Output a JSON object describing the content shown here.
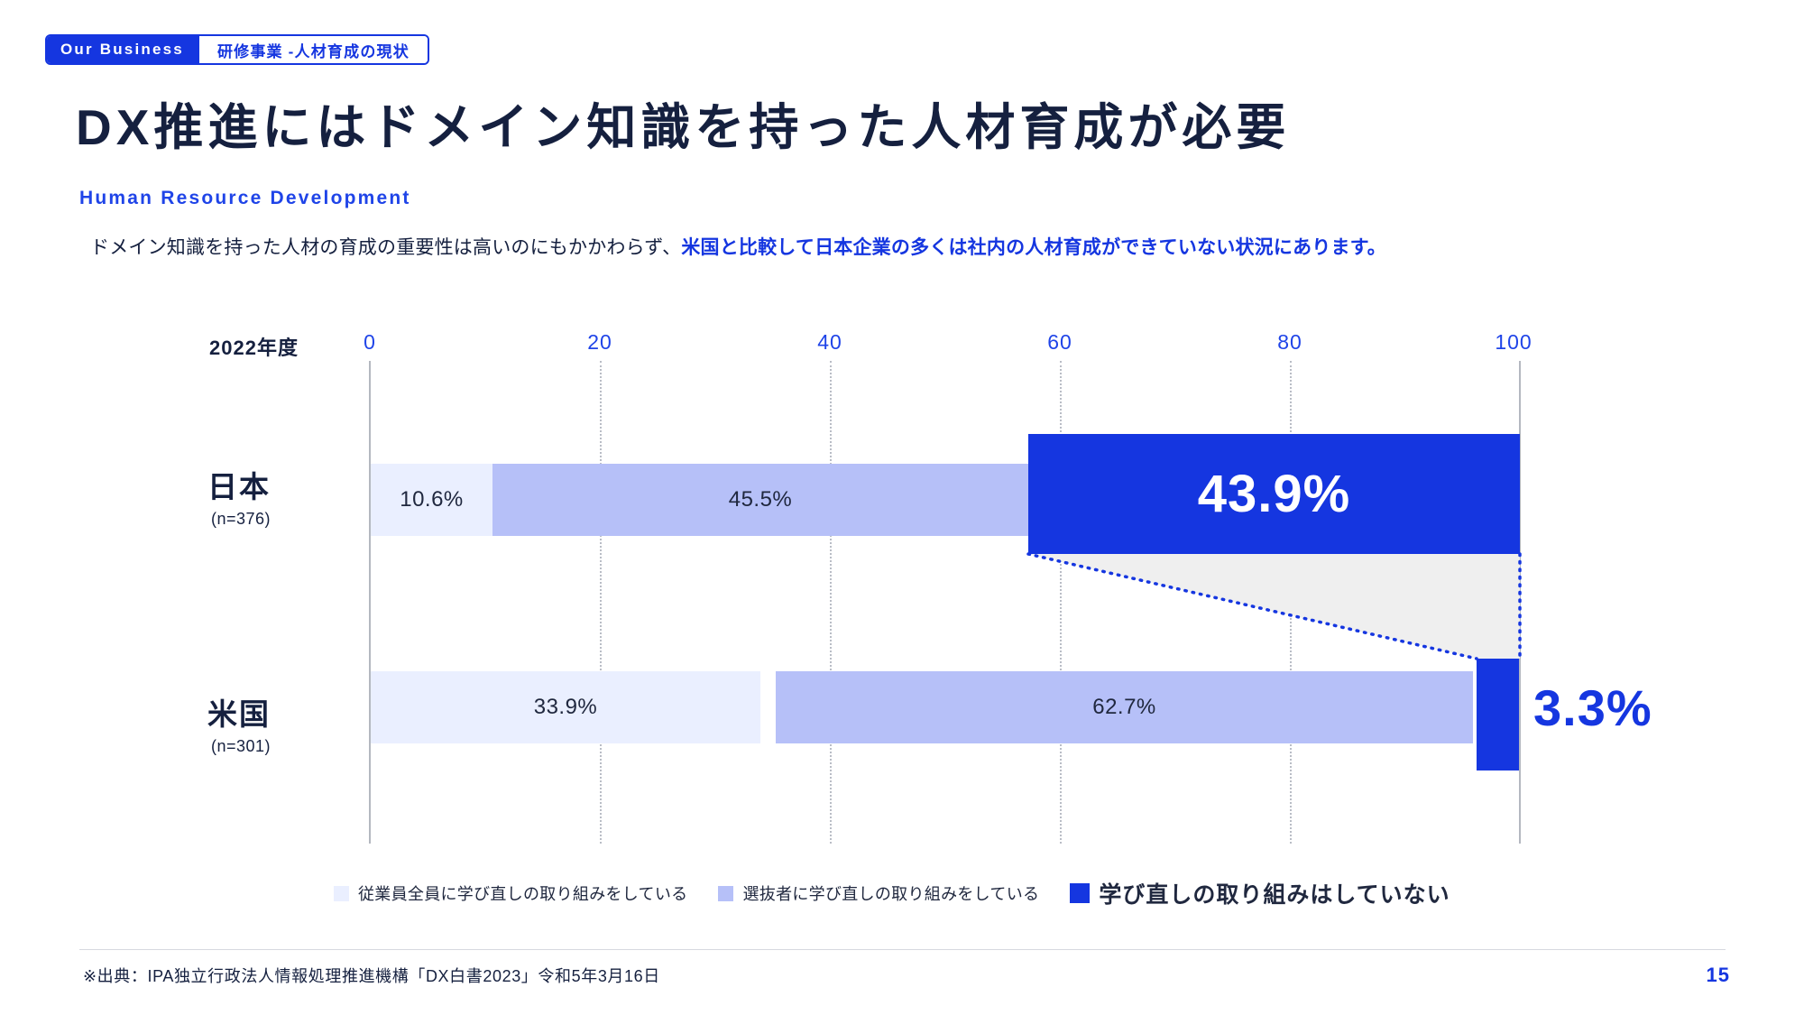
{
  "header": {
    "badge_left": "Our Business",
    "badge_right": "研修事業 -人材育成の現状"
  },
  "title": "DX推進にはドメイン知識を持った人材育成が必要",
  "subtitle": "Human Resource Development",
  "lead": {
    "plain": "ドメイン知識を持った人材の育成の重要性は高いのにもかかわらず、",
    "highlight": "米国と比較して日本企業の多くは社内の人材育成ができていない状況にあります。"
  },
  "footer": {
    "source": "※出典：IPA独立行政法人情報処理推進機構「DX白書2023」令和5年3月16日",
    "page_number": "15"
  },
  "chart_data": {
    "type": "bar",
    "orientation": "horizontal",
    "stacked": true,
    "title": "",
    "year_label": "2022年度",
    "xlabel": "",
    "ylabel": "",
    "xlim": [
      0,
      100
    ],
    "xticks": [
      "0",
      "20",
      "40",
      "60",
      "80",
      "100"
    ],
    "grid": true,
    "legend_position": "bottom",
    "series": [
      {
        "name": "従業員全員に学び直しの取り組みをしている",
        "color": "#eaefff",
        "values": [
          10.6,
          33.9
        ],
        "labels": [
          "10.6%",
          "33.9%"
        ]
      },
      {
        "name": "選抜者に学び直しの取り組みをしている",
        "color": "#b6c0f8",
        "values": [
          45.5,
          62.7
        ],
        "labels": [
          "45.5%",
          "62.7%"
        ]
      },
      {
        "name": "学び直しの取り組みはしていない",
        "color": "#1536e0",
        "values": [
          43.9,
          3.3
        ],
        "labels": [
          "43.9%",
          "3.3%"
        ]
      }
    ],
    "categories": [
      {
        "name": "日本",
        "n": "(n=376)"
      },
      {
        "name": "米国",
        "n": "(n=301)"
      }
    ],
    "callout": "3.3%",
    "accent_color": "#1536e0"
  }
}
